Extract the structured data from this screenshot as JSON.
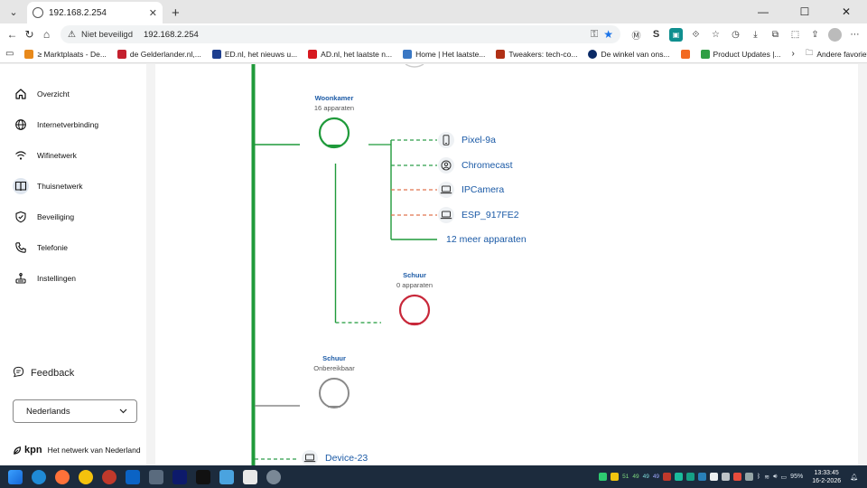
{
  "browser": {
    "tab_title": "192.168.2.254",
    "new_tab": "+",
    "security_label": "Niet beveiligd",
    "url": "192.168.2.254",
    "bookmarks": [
      {
        "label": "≥ Marktplaats - De...",
        "color": "#e8891b"
      },
      {
        "label": "de Gelderlander.nl,...",
        "color": "#c4202e"
      },
      {
        "label": "ED.nl, het nieuws u...",
        "color": "#1e3f8f"
      },
      {
        "label": "AD.nl, het laatste n...",
        "color": "#d71920"
      },
      {
        "label": "Home | Het laatste...",
        "color": "#3a78c4"
      },
      {
        "label": "Tweakers: tech-co...",
        "color": "#b03015"
      },
      {
        "label": "De winkel van ons...",
        "color": "#0a2a66"
      },
      {
        "label": "",
        "color": "#f26a21"
      },
      {
        "label": "Product Updates |...",
        "color": "#2f9e44"
      }
    ],
    "bookmarks_folder": "Andere favorieten"
  },
  "sidebar": {
    "items": [
      {
        "label": "Overzicht",
        "icon": "home-icon"
      },
      {
        "label": "Internetverbinding",
        "icon": "globe-icon"
      },
      {
        "label": "Wifinetwerk",
        "icon": "wifi-icon"
      },
      {
        "label": "Thuisnetwerk",
        "icon": "book-icon"
      },
      {
        "label": "Beveiliging",
        "icon": "shield-icon"
      },
      {
        "label": "Telefonie",
        "icon": "phone-icon"
      },
      {
        "label": "Instellingen",
        "icon": "settings-icon"
      }
    ],
    "active_index": 3,
    "feedback": "Feedback",
    "language": "Nederlands",
    "brand_logo": "kpn",
    "brand_tagline": "Het netwerk van Nederland"
  },
  "network": {
    "woonkamer": {
      "name": "Woonkamer",
      "status": "16 apparaten",
      "color": "#1f9a3a"
    },
    "devices": [
      {
        "name": "Pixel-9a",
        "icon": "smartphone-icon",
        "link_color": "#2e9e4a"
      },
      {
        "name": "Chromecast",
        "icon": "person-icon",
        "link_color": "#2e9e4a"
      },
      {
        "name": "IPCamera",
        "icon": "laptop-icon",
        "link_color": "#e0734f"
      },
      {
        "name": "ESP_917FE2",
        "icon": "laptop-icon",
        "link_color": "#e0734f"
      }
    ],
    "more_devices": "12 meer apparaten",
    "schuur_online": {
      "name": "Schuur",
      "status": "0 apparaten",
      "color": "#c8283a"
    },
    "schuur_offline": {
      "name": "Schuur",
      "status": "Onbereikbaar",
      "color": "#8a8a8a"
    },
    "bottom_device": {
      "name": "Device-23",
      "icon": "laptop-icon"
    },
    "trunk_color": "#1f9a3a"
  },
  "taskbar": {
    "time": "13:33:45",
    "date": "16-2-2026",
    "battery": "95%",
    "tray_numbers": [
      "51",
      "49",
      "49",
      "49"
    ]
  }
}
